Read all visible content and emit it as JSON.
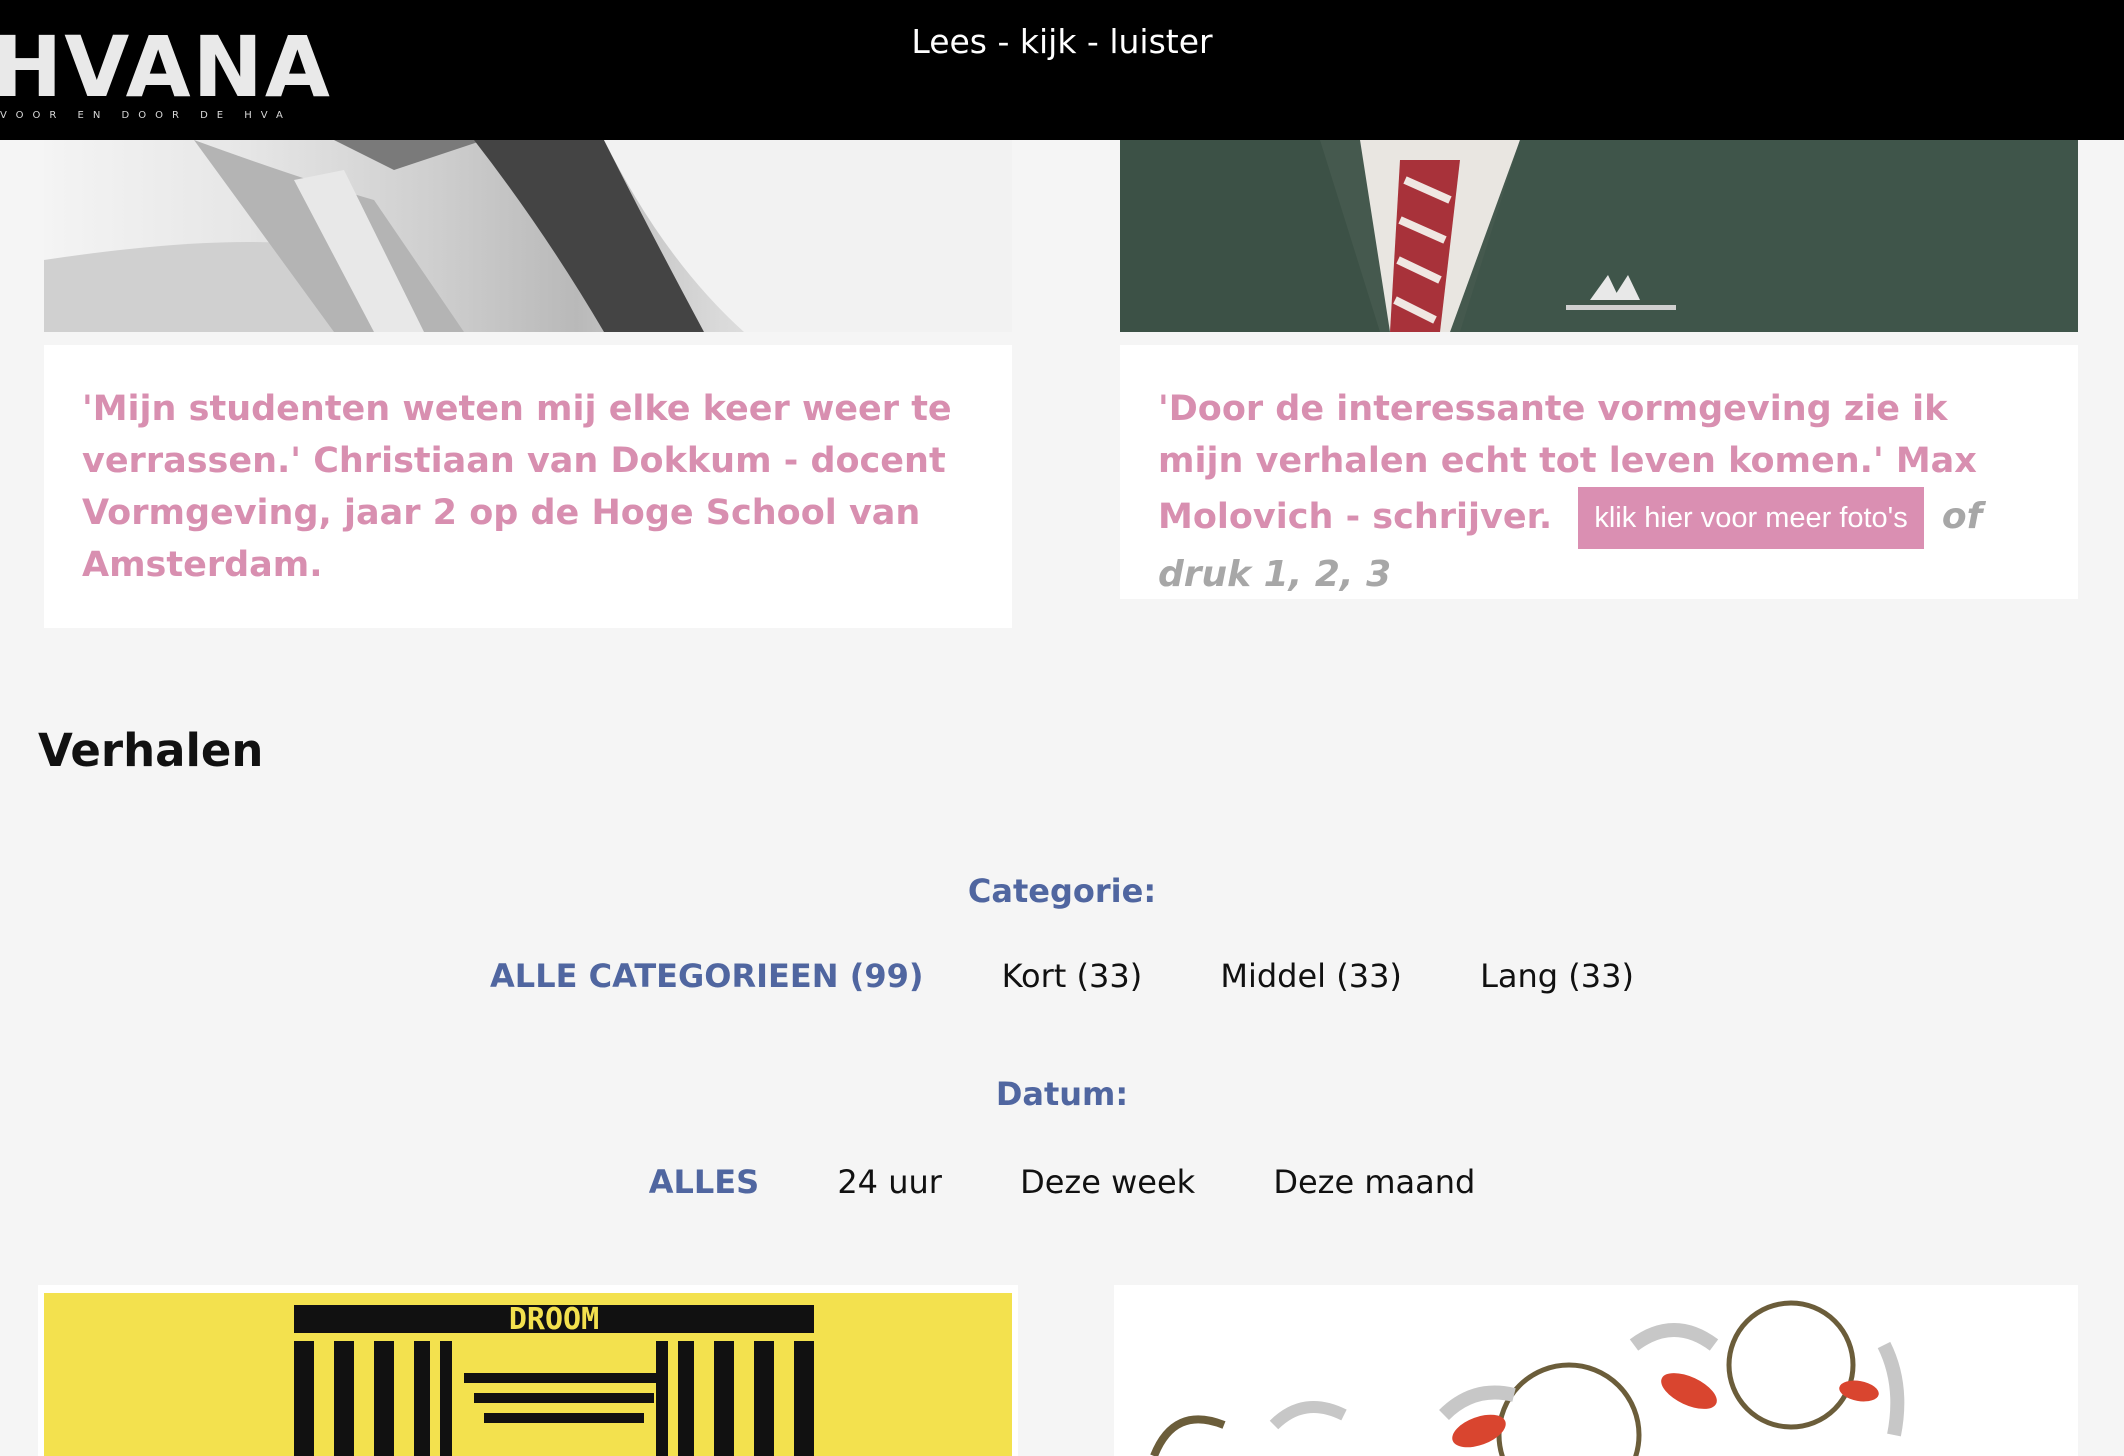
{
  "header": {
    "logo": "HVANA",
    "logo_tagline": "VOOR EN DOOR DE HVA",
    "nav": "Lees - kijk - luister"
  },
  "cards_top": [
    {
      "quote": "'Mijn studenten weten mij elke keer weer te verrassen.' Christiaan van Dokkum - docent Vormgeving, jaar 2 op de Hoge School van Amsterdam."
    },
    {
      "quote": "'Door de interessante vormgeving zie ik mijn verhalen echt tot leven komen.' Max Molovich - schrijver.",
      "button": "klik hier voor meer foto's",
      "druk": "of druk 1, 2, 3"
    }
  ],
  "section_title": "Verhalen",
  "filters": {
    "category_label": "Categorie:",
    "categories": [
      "ALLE CATEGORIEEN (99)",
      "Kort (33)",
      "Middel (33)",
      "Lang (33)"
    ],
    "date_label": "Datum:",
    "dates": [
      "ALLES",
      "24 uur",
      "Deze week",
      "Deze maand"
    ]
  },
  "story_cards": {
    "left_image_text": "DROOM"
  },
  "colors": {
    "pink": "#d88fb0",
    "accent_blue": "#5066a0",
    "header_bg": "#000000",
    "yellow": "#f3e14e"
  }
}
